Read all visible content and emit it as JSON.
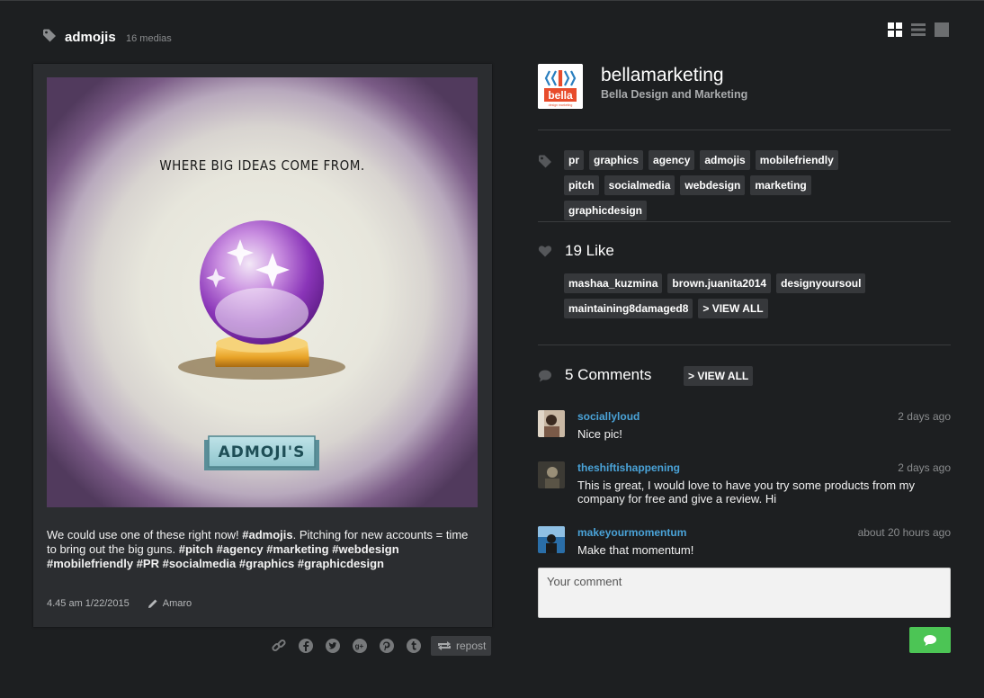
{
  "header": {
    "tag_icon": "tag-icon",
    "title": "admojis",
    "count": "16 medias",
    "view_icons": [
      "grid-view-icon",
      "list-view-icon",
      "single-view-icon"
    ]
  },
  "post": {
    "image_caption": "WHERE BIG IDEAS COME FROM.",
    "image_banner": "ADMOJI'S",
    "caption_parts": [
      {
        "text": "We could use one of these right now! ",
        "bold": false
      },
      {
        "text": "#admojis",
        "bold": true
      },
      {
        "text": ". Pitching for new accounts = time to bring out the big guns. ",
        "bold": false
      },
      {
        "text": "#pitch #agency #marketing #webdesign #mobilefriendly #PR #socialmedia #graphics #graphicdesign",
        "bold": true
      }
    ],
    "timestamp": "4.45 am 1/22/2015",
    "filter": "Amaro"
  },
  "share": {
    "icons": [
      "link-icon",
      "facebook-icon",
      "twitter-icon",
      "google-plus-icon",
      "pinterest-icon",
      "tumblr-icon"
    ],
    "repost_label": "repost"
  },
  "user": {
    "avatar_label": "bella",
    "avatar_sub": "design marketing",
    "username": "bellamarketing",
    "fullname": "Bella Design and Marketing"
  },
  "tags": [
    "pr",
    "graphics",
    "agency",
    "admojis",
    "mobilefriendly",
    "pitch",
    "socialmedia",
    "webdesign",
    "marketing",
    "graphicdesign"
  ],
  "likes": {
    "title": "19 Like",
    "users": [
      "mashaa_kuzmina",
      "brown.juanita2014",
      "designyoursoul",
      "maintaining8damaged8"
    ],
    "view_all": "> VIEW ALL"
  },
  "comments": {
    "title": "5 Comments",
    "view_all": "> VIEW ALL",
    "items": [
      {
        "user": "sociallyloud",
        "time": "2 days ago",
        "text": "Nice pic!"
      },
      {
        "user": "theshiftishappening",
        "time": "2 days ago",
        "text": "This is great, I would love to have you try some products from my company for free and give a review. Hi"
      },
      {
        "user": "makeyourmomentum",
        "time": "about 20 hours ago",
        "text": "Make that momentum!"
      }
    ],
    "placeholder": "Your comment",
    "send_icon": "chat-bubble-icon"
  },
  "colors": {
    "background": "#1d1f21",
    "card": "#2b2d30",
    "chip": "#36383b",
    "link": "#4aa3d8",
    "send": "#4cc555"
  }
}
